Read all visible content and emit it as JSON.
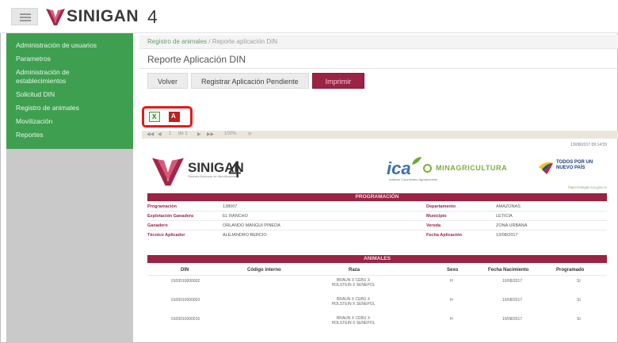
{
  "header": {
    "brand": "SINIGAN",
    "version": "4"
  },
  "sidebar": {
    "items": [
      {
        "label": "Administración de usuarios"
      },
      {
        "label": "Parametros"
      },
      {
        "label": "Administración de establecimientos"
      },
      {
        "label": "Solicitud DIN"
      },
      {
        "label": "Registro de animales"
      },
      {
        "label": "Movilización"
      },
      {
        "label": "Reportes"
      }
    ]
  },
  "breadcrumb": {
    "link": "Registro de animales",
    "separator": " / ",
    "current": "Reporte aplicación DIN"
  },
  "page": {
    "title": "Reporte Aplicación DIN"
  },
  "actions": {
    "back": "Volver",
    "register": "Registrar Aplicación Pendiente",
    "print": "Imprimir"
  },
  "toolbar": {
    "excel_label": "X",
    "pdf_label": "A"
  },
  "viewer": {
    "page": "1",
    "of": "de 1",
    "zoom": "100%"
  },
  "report": {
    "generated": "13/08/2017 09:14:55",
    "brand": "SINIGAN",
    "brand_sub": "Sistema Nacional de Identificación",
    "brand_num": "4",
    "ica": "ica",
    "ica_sub": "Instituto Colombiano Agropecuario",
    "minag": "MINAGRICULTURA",
    "todos": [
      "TODOS POR UN",
      "NUEVO PAÍS"
    ],
    "minag_web": "https://sinigan.ica.gov.co",
    "programming_header": "PROGRAMACIÓN",
    "programming": {
      "left": [
        {
          "k": "Programación",
          "v": "138007"
        },
        {
          "k": "Explotación Ganadera",
          "v": "EL RANCHO"
        },
        {
          "k": "Ganadero",
          "v": "ORLANDO MANGUI PINEDA"
        },
        {
          "k": "Técnico Aplicador",
          "v": "ALEJANDRO BERCIO"
        }
      ],
      "right": [
        {
          "k": "Departamento",
          "v": "AMAZONAS"
        },
        {
          "k": "Municipio",
          "v": "LETICIA"
        },
        {
          "k": "Vereda",
          "v": "ZONA URBANA"
        },
        {
          "k": "Fecha Aplicación",
          "v": "13/08/2017"
        }
      ]
    },
    "animals_header": "ANIMALES",
    "animals_columns": [
      "DIN",
      "Código interno",
      "Raza",
      "Sexo",
      "Fecha Nacimiento",
      "Programado"
    ],
    "animals": [
      {
        "din": "0100010000002",
        "codigo": "",
        "raza": "BRAUN X CEBU X HOLSTEIN X SENEPOL",
        "sexo": "H",
        "fecha": "10/08/2017",
        "prog": "SI"
      },
      {
        "din": "0100010000003",
        "codigo": "",
        "raza": "BRAUN X CEBU X HOLSTEIN X SENEPOL",
        "sexo": "H",
        "fecha": "10/08/2017",
        "prog": "SI"
      },
      {
        "din": "0100010000016",
        "codigo": "",
        "raza": "BRAUN X CEBU X HOLSTEIN X SENEPOL",
        "sexo": "H",
        "fecha": "10/08/2017",
        "prog": "SI"
      }
    ]
  },
  "colors": {
    "green": "#3f9f50",
    "maroon": "#9b2344",
    "highlight": "#e41a1a"
  }
}
